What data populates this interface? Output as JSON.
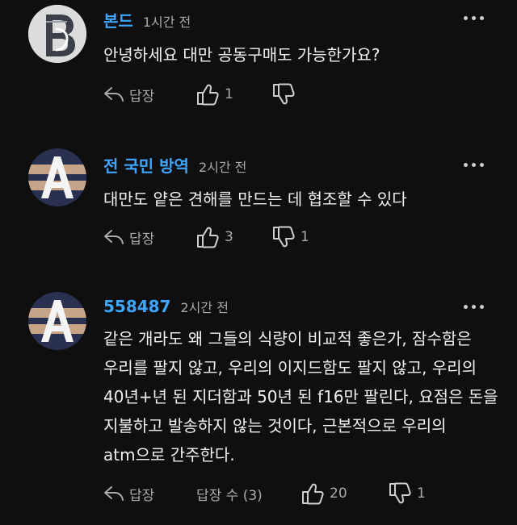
{
  "comments": [
    {
      "author": "본드",
      "time": "1시간 전",
      "text": "안녕하세요 대만 공동구매도 가능한가요?",
      "reply_label": "답장",
      "likes": "1",
      "dislikes": "",
      "replies_label": ""
    },
    {
      "author": "전 국민 방역",
      "time": "2시간 전",
      "text": "대만도 얕은 견해를 만드는 데 협조할 수 있다",
      "reply_label": "답장",
      "likes": "3",
      "dislikes": "1",
      "replies_label": ""
    },
    {
      "author": "558487",
      "time": "2시간 전",
      "text": "같은 개라도 왜 그들의 식량이 비교적 좋은가, 잠수함은 우리를 팔지 않고, 우리의 이지드함도 팔지 않고, 우리의 40년+년 된 지더함과 50년 된 f16만 팔린다, 요점은 돈을 지불하고 발송하지 않는 것이다, 근본적으로 우리의 atm으로 간주한다.",
      "reply_label": "답장",
      "likes": "20",
      "dislikes": "1",
      "replies_label": "답장 수 (3)"
    }
  ],
  "icons": {
    "reply": "reply-arrow-icon",
    "like": "thumbs-up-icon",
    "dislike": "thumbs-down-icon",
    "more": "more-dots-icon"
  }
}
